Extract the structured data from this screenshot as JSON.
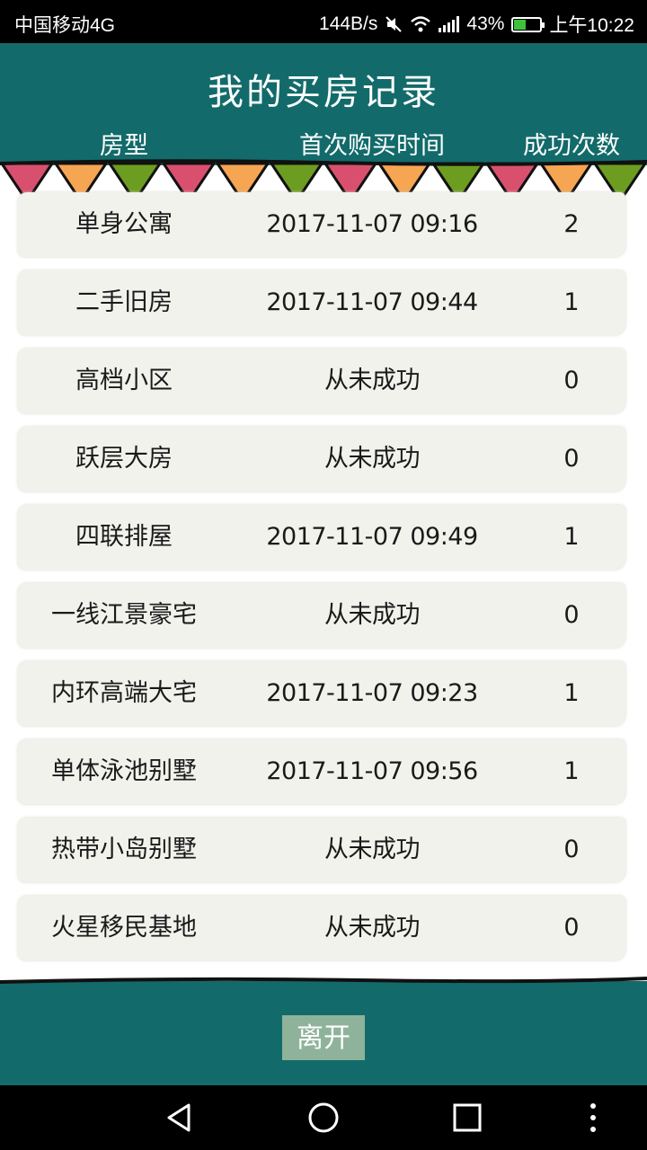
{
  "status_bar": {
    "carrier": "中国移动4G",
    "speed": "144B/s",
    "battery": "43%",
    "battery_level": 0.43,
    "time": "上午10:22",
    "icons": [
      "mute-icon",
      "wifi-icon",
      "signal-icon",
      "battery-icon"
    ]
  },
  "header": {
    "title": "我的买房记录",
    "columns": [
      "房型",
      "首次购买时间",
      "成功次数"
    ],
    "bg_color": "#136a6a",
    "bunting_colors": [
      "#d9506f",
      "#f6a553",
      "#6c9d21"
    ]
  },
  "rows": [
    {
      "type": "单身公寓",
      "time": "2017-11-07 09:16",
      "count": "2"
    },
    {
      "type": "二手旧房",
      "time": "2017-11-07 09:44",
      "count": "1"
    },
    {
      "type": "高档小区",
      "time": "从未成功",
      "count": "0"
    },
    {
      "type": "跃层大房",
      "time": "从未成功",
      "count": "0"
    },
    {
      "type": "四联排屋",
      "time": "2017-11-07 09:49",
      "count": "1"
    },
    {
      "type": "一线江景豪宅",
      "time": "从未成功",
      "count": "0"
    },
    {
      "type": "内环高端大宅",
      "time": "2017-11-07 09:23",
      "count": "1"
    },
    {
      "type": "单体泳池别墅",
      "time": "2017-11-07 09:56",
      "count": "1"
    },
    {
      "type": "热带小岛别墅",
      "time": "从未成功",
      "count": "0"
    },
    {
      "type": "火星移民基地",
      "time": "从未成功",
      "count": "0"
    }
  ],
  "footer": {
    "leave_label": "离开"
  },
  "nav_bar": {
    "icons": [
      "back-icon",
      "home-icon",
      "recents-icon",
      "more-icon"
    ]
  }
}
